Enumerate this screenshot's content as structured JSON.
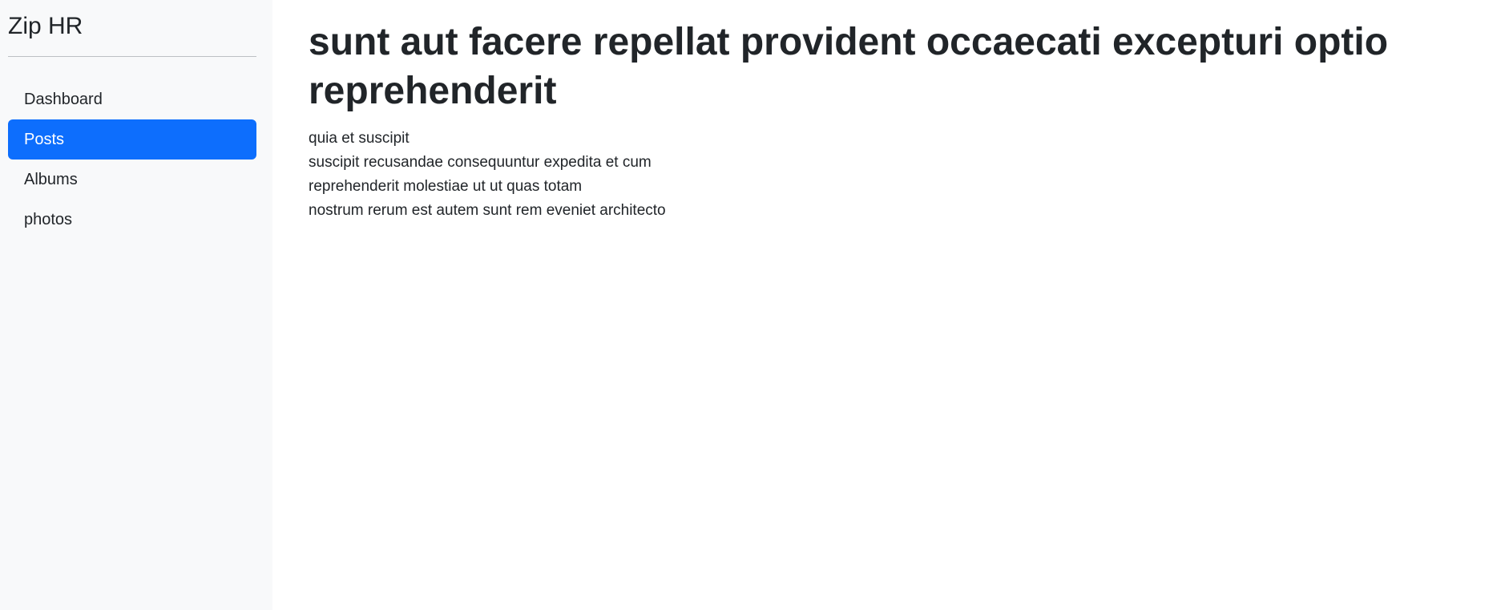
{
  "colors": {
    "accent": "#0d6efd",
    "sidebar_bg": "#f8f9fa",
    "text": "#212529"
  },
  "sidebar": {
    "brand": "Zip HR",
    "items": [
      {
        "label": "Dashboard",
        "active": false
      },
      {
        "label": "Posts",
        "active": true
      },
      {
        "label": "Albums",
        "active": false
      },
      {
        "label": "photos",
        "active": false
      }
    ]
  },
  "post": {
    "title": "sunt aut facere repellat provident occaecati excepturi optio reprehenderit",
    "body_lines": [
      "quia et suscipit",
      "suscipit recusandae consequuntur expedita et cum",
      "reprehenderit molestiae ut ut quas totam",
      "nostrum rerum est autem sunt rem eveniet architecto"
    ]
  }
}
